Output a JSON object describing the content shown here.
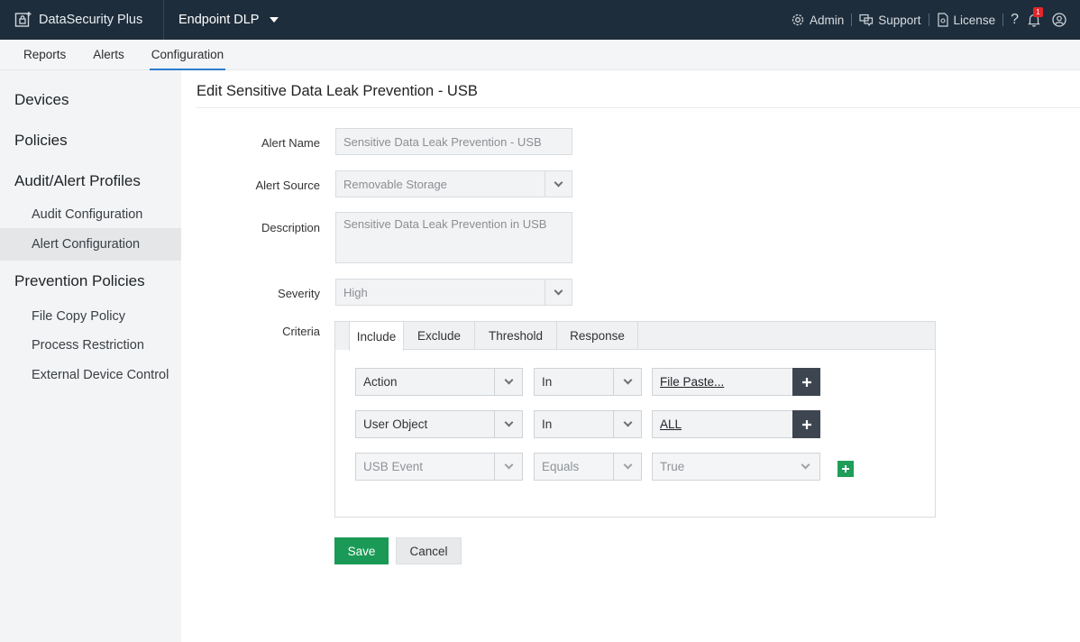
{
  "topbar": {
    "brand": "DataSecurity Plus",
    "product": "Endpoint DLP",
    "admin": "Admin",
    "support": "Support",
    "license": "License",
    "help": "?",
    "notifications_count": "1"
  },
  "nav": {
    "tabs": [
      "Reports",
      "Alerts",
      "Configuration"
    ],
    "active": "Configuration"
  },
  "sidebar": {
    "devices": "Devices",
    "policies": "Policies",
    "audit_alert_profiles": "Audit/Alert Profiles",
    "audit_configuration": "Audit Configuration",
    "alert_configuration": "Alert Configuration",
    "prevention_policies": "Prevention Policies",
    "file_copy_policy": "File Copy Policy",
    "process_restriction": "Process Restriction",
    "external_device_control": "External Device Control"
  },
  "form": {
    "title": "Edit Sensitive Data Leak Prevention - USB",
    "alert_name_label": "Alert Name",
    "alert_name_value": "Sensitive Data Leak Prevention - USB",
    "alert_source_label": "Alert Source",
    "alert_source_value": "Removable Storage",
    "description_label": "Description",
    "description_value": "Sensitive Data Leak Prevention in USB",
    "severity_label": "Severity",
    "severity_value": "High",
    "criteria_label": "Criteria"
  },
  "criteria": {
    "tabs": [
      "Include",
      "Exclude",
      "Threshold",
      "Response"
    ],
    "active_tab": "Include",
    "rows": [
      {
        "field": "Action",
        "operator": "In",
        "value": "File Paste..."
      },
      {
        "field": "User Object",
        "operator": "In",
        "value": "ALL"
      },
      {
        "field": "USB Event",
        "operator": "Equals",
        "value": "True"
      }
    ]
  },
  "buttons": {
    "save": "Save",
    "cancel": "Cancel"
  },
  "colors": {
    "topbar": "#1e2d3b",
    "accent": "#2d7bd0",
    "save": "#1a9a56",
    "add": "#1e9e58"
  }
}
